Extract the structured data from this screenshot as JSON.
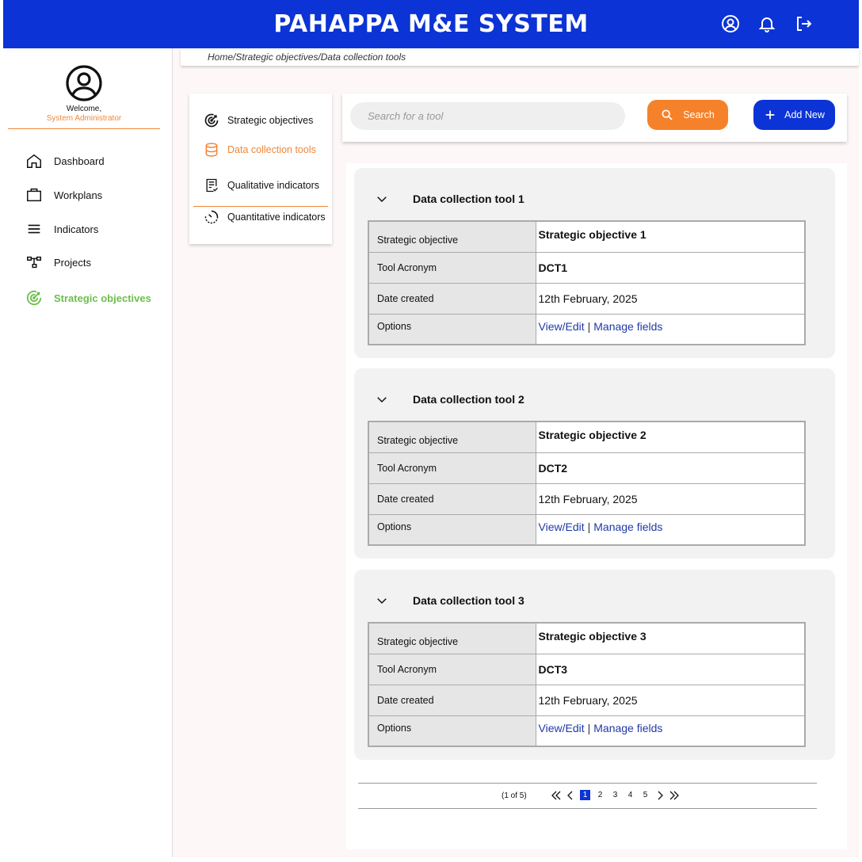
{
  "header": {
    "title": "PAHAPPA M&E SYSTEM"
  },
  "profile": {
    "welcome": "Welcome,",
    "role": "System Administrator"
  },
  "sidebar": {
    "items": [
      {
        "label": "Dashboard",
        "icon": "home-icon"
      },
      {
        "label": "Workplans",
        "icon": "briefcase-icon"
      },
      {
        "label": "Indicators",
        "icon": "menu-lines-icon"
      },
      {
        "label": "Projects",
        "icon": "hierarchy-icon"
      },
      {
        "label": "Strategic objectives",
        "icon": "target-icon",
        "active": true
      }
    ]
  },
  "breadcrumb": "Home/Strategic objectives/Data collection tools",
  "submenu": {
    "items": [
      {
        "label": "Strategic objectives",
        "icon": "target-icon"
      },
      {
        "label": "Data collection tools",
        "icon": "database-icon",
        "active": true
      },
      {
        "label": "Qualitative indicators",
        "icon": "checklist-icon"
      },
      {
        "label": "Quantitative indicators",
        "icon": "gauge-icon"
      }
    ]
  },
  "search": {
    "placeholder": "Search for a tool",
    "button": "Search",
    "add_button": "Add New"
  },
  "row_labels": {
    "objective": "Strategic objective",
    "acronym": "Tool Acronym",
    "date": "Date created",
    "options": "Options"
  },
  "actions": {
    "view": "View/Edit",
    "separator": "|",
    "manage": "Manage fields"
  },
  "tools": [
    {
      "name": "Data collection tool 1",
      "objective": "Strategic objective 1",
      "acronym": "DCT1",
      "date": "12th February, 2025"
    },
    {
      "name": "Data collection tool 2",
      "objective": "Strategic objective 2",
      "acronym": "DCT2",
      "date": "12th February, 2025"
    },
    {
      "name": "Data collection tool 3",
      "objective": "Strategic objective 3",
      "acronym": "DCT3",
      "date": "12th February, 2025"
    }
  ],
  "pagination": {
    "count": "(1 of 5)",
    "pages": [
      "1",
      "2",
      "3",
      "4",
      "5"
    ],
    "current": "1"
  },
  "colors": {
    "brand_blue": "#0b33d6",
    "accent_orange": "#f5822a",
    "active_green": "#6cbf4b",
    "link_blue": "#1f3aa8"
  }
}
